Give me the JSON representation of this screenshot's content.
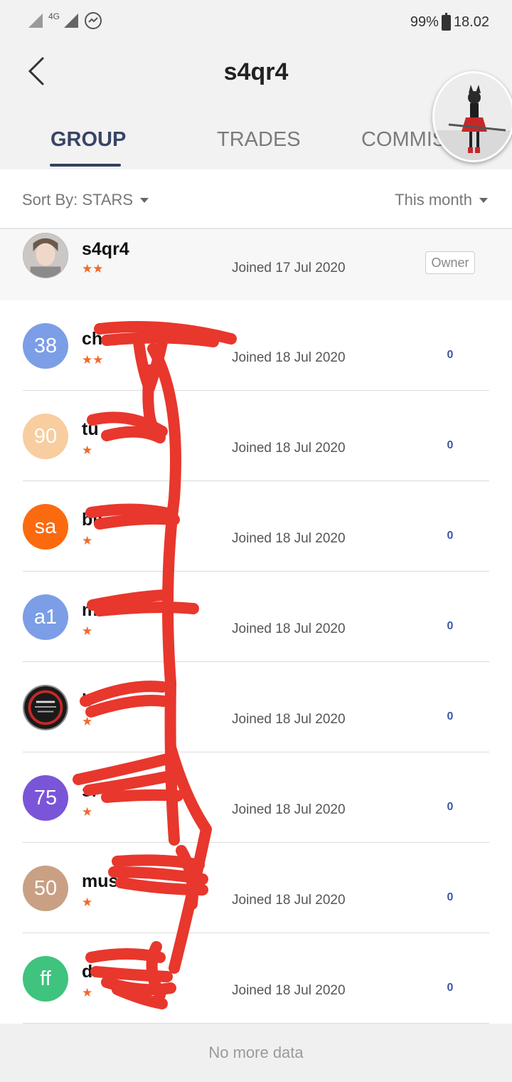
{
  "status_bar": {
    "network": "4G",
    "battery": "99%",
    "time": "18.02"
  },
  "header": {
    "title": "s4qr4"
  },
  "tabs": [
    {
      "label": "GROUP",
      "active": true
    },
    {
      "label": "TRADES",
      "active": false
    },
    {
      "label": "COMMIS",
      "active": false
    }
  ],
  "sort": {
    "label": "Sort By: STARS",
    "period": "This month"
  },
  "members": [
    {
      "avatar_text": "",
      "avatar_color": "#cfcfcf",
      "name": "s4qr4",
      "stars": "★★",
      "joined": "Joined 17 Jul 2020",
      "badge": "Owner"
    },
    {
      "avatar_text": "38",
      "avatar_color": "#7b9ee6",
      "name": "ch",
      "stars": "★★",
      "joined": "Joined 18 Jul 2020",
      "count": "0"
    },
    {
      "avatar_text": "90",
      "avatar_color": "#f8cd9f",
      "name": "tu",
      "stars": "★",
      "joined": "Joined 18 Jul 2020",
      "count": "0"
    },
    {
      "avatar_text": "sa",
      "avatar_color": "#fb6a0f",
      "name": "bil",
      "stars": "★",
      "joined": "Joined 18 Jul 2020",
      "count": "0"
    },
    {
      "avatar_text": "a1",
      "avatar_color": "#7b9ee6",
      "name": "m",
      "stars": "★",
      "joined": "Joined 18 Jul 2020",
      "count": "0"
    },
    {
      "avatar_text": "",
      "avatar_color": "#2a2a2a",
      "name": "b",
      "stars": "★",
      "joined": "Joined 18 Jul 2020",
      "count": "0"
    },
    {
      "avatar_text": "75",
      "avatar_color": "#7a55d8",
      "name": "sl",
      "stars": "★",
      "joined": "Joined 18 Jul 2020",
      "count": "0"
    },
    {
      "avatar_text": "50",
      "avatar_color": "#c9a084",
      "name": "must",
      "stars": "★",
      "joined": "Joined 18 Jul 2020",
      "count": "0"
    },
    {
      "avatar_text": "ff",
      "avatar_color": "#3fc37e",
      "name": "de",
      "stars": "★",
      "joined": "Joined 18 Jul 2020",
      "count": "0"
    }
  ],
  "footer": {
    "text": "No more data"
  }
}
